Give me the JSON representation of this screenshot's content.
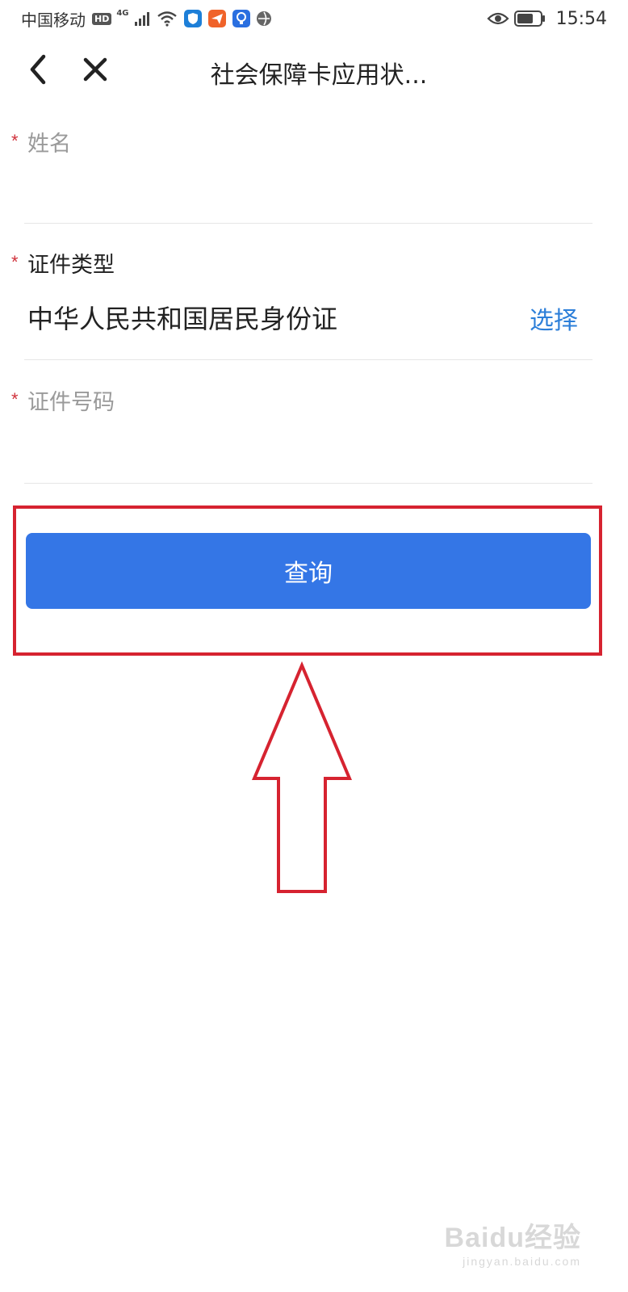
{
  "status_bar": {
    "carrier": "中国移动",
    "hd_badge": "HD",
    "network_type": "4G",
    "time": "15:54",
    "icons": [
      "hd-icon",
      "signal-icon",
      "wifi-icon",
      "shield-app-icon",
      "send-app-icon",
      "bulb-app-icon",
      "globe-app-icon",
      "eye-icon",
      "battery-icon"
    ]
  },
  "nav": {
    "title": "社会保障卡应用状...",
    "back_icon": "back-chevron-icon",
    "close_icon": "close-icon"
  },
  "form": {
    "name": {
      "required_mark": "*",
      "label": "姓名",
      "value": ""
    },
    "id_type": {
      "required_mark": "*",
      "label": "证件类型",
      "value": "中华人民共和国居民身份证",
      "select_label": "选择"
    },
    "id_number": {
      "required_mark": "*",
      "label": "证件号码",
      "value": ""
    }
  },
  "query_button": {
    "label": "查询"
  },
  "watermark": {
    "main": "Baidu经验",
    "sub": "jingyan.baidu.com"
  },
  "colors": {
    "primary_button": "#3476e6",
    "select_link": "#2d7fd9",
    "required_star": "#d0323c",
    "annotation_red": "#d62330"
  }
}
